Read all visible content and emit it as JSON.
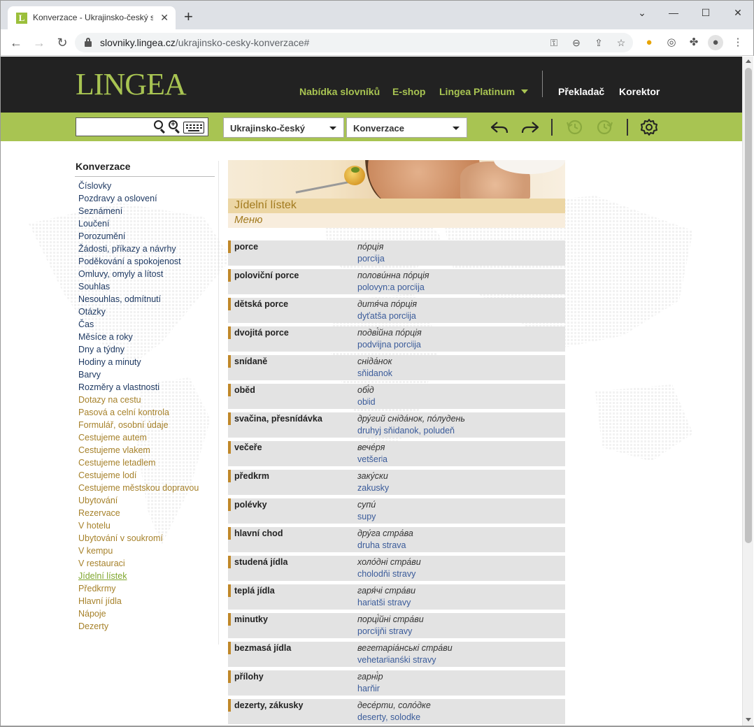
{
  "browser": {
    "tab_title": "Konverzace - Ukrajinsko-český slovník",
    "favicon_letter": "L",
    "url_host": "slovniky.lingea.cz",
    "url_path": "/ukrajinsko-cesky-konverzace#"
  },
  "header": {
    "logo": "LINGEA",
    "nav": {
      "dictionaries": "Nabídka slovníků",
      "eshop": "E-shop",
      "platinum": "Lingea Platinum",
      "translator": "Překladač",
      "corrector": "Korektor"
    }
  },
  "search": {
    "value": "",
    "direction": "Ukrajinsko-český",
    "section": "Konverzace"
  },
  "sidebar": {
    "title": "Konverzace",
    "items": [
      {
        "label": "Číslovky",
        "style": "blue"
      },
      {
        "label": "Pozdravy a oslovení",
        "style": "blue"
      },
      {
        "label": "Seznámení",
        "style": "blue"
      },
      {
        "label": "Loučení",
        "style": "blue"
      },
      {
        "label": "Porozumění",
        "style": "blue"
      },
      {
        "label": "Žádosti, příkazy a návrhy",
        "style": "blue"
      },
      {
        "label": "Poděkování a spokojenost",
        "style": "blue"
      },
      {
        "label": "Omluvy, omyly a lítost",
        "style": "blue"
      },
      {
        "label": "Souhlas",
        "style": "blue"
      },
      {
        "label": "Nesouhlas, odmítnutí",
        "style": "blue"
      },
      {
        "label": "Otázky",
        "style": "blue"
      },
      {
        "label": "Čas",
        "style": "blue"
      },
      {
        "label": "Měsíce a roky",
        "style": "blue"
      },
      {
        "label": "Dny a týdny",
        "style": "blue"
      },
      {
        "label": "Hodiny a minuty",
        "style": "blue"
      },
      {
        "label": "Barvy",
        "style": "blue"
      },
      {
        "label": "Rozměry a vlastnosti",
        "style": "blue"
      },
      {
        "label": "Dotazy na cestu",
        "style": "orange"
      },
      {
        "label": "Pasová a celní kontrola",
        "style": "orange"
      },
      {
        "label": "Formulář, osobní údaje",
        "style": "orange"
      },
      {
        "label": "Cestujeme autem",
        "style": "orange"
      },
      {
        "label": "Cestujeme vlakem",
        "style": "orange"
      },
      {
        "label": "Cestujeme letadlem",
        "style": "orange"
      },
      {
        "label": "Cestujeme lodí",
        "style": "orange"
      },
      {
        "label": "Cestujeme městskou dopravou",
        "style": "orange"
      },
      {
        "label": "Ubytování",
        "style": "orange"
      },
      {
        "label": "Rezervace",
        "style": "orange"
      },
      {
        "label": "V hotelu",
        "style": "orange"
      },
      {
        "label": "Ubytování v soukromí",
        "style": "orange"
      },
      {
        "label": "V kempu",
        "style": "orange"
      },
      {
        "label": "V restauraci",
        "style": "orange"
      },
      {
        "label": "Jídelní lístek",
        "style": "active"
      },
      {
        "label": "Předkrmy",
        "style": "orange"
      },
      {
        "label": "Hlavní jídla",
        "style": "orange"
      },
      {
        "label": "Nápoje",
        "style": "orange"
      },
      {
        "label": "Dezerty",
        "style": "orange"
      }
    ]
  },
  "main": {
    "title": "Jídelní lístek",
    "subtitle": "Меню",
    "entries": [
      {
        "cs": "porce",
        "uk": "по́рція",
        "tr": "porcʲija"
      },
      {
        "cs": "poloviční porce",
        "uk": "полови́нна по́рція",
        "tr": "polovyn:a porcʲija"
      },
      {
        "cs": "dětská porce",
        "uk": "дитя́ча по́рція",
        "tr": "dyťatša porcʲija"
      },
      {
        "cs": "dvojitá porce",
        "uk": "подві́йна по́рція",
        "tr": "podvʲijna porcʲija"
      },
      {
        "cs": "snídaně",
        "uk": "сніда́нок",
        "tr": "sňidanok"
      },
      {
        "cs": "oběd",
        "uk": "обі́д",
        "tr": "obʲid"
      },
      {
        "cs": "svačina, přesnídávka",
        "uk": "дру́гий сніда́нок, по́лудень",
        "tr": "druhyj sňidanok, poludeň"
      },
      {
        "cs": "večeře",
        "uk": "вече́ря",
        "tr": "vetšerʲa"
      },
      {
        "cs": "předkrm",
        "uk": "заку́ски",
        "tr": "zakusky"
      },
      {
        "cs": "polévky",
        "uk": "супи́",
        "tr": "supy"
      },
      {
        "cs": "hlavní chod",
        "uk": "дру́га стра́ва",
        "tr": "druha strava"
      },
      {
        "cs": "studená jídla",
        "uk": "холо́дні стра́ви",
        "tr": "cholodňi stravy"
      },
      {
        "cs": "teplá jídla",
        "uk": "гаря́чі стра́ви",
        "tr": "harʲatši stravy"
      },
      {
        "cs": "minutky",
        "uk": "порці́йні стра́ви",
        "tr": "porcʲijňi stravy"
      },
      {
        "cs": "bezmasá jídla",
        "uk": "вегетаріа́нські стра́ви",
        "tr": "vehetarʲianśki stravy"
      },
      {
        "cs": "přílohy",
        "uk": "гарні́р",
        "tr": "harňir"
      },
      {
        "cs": "dezerty, zákusky",
        "uk": "десе́рти, соло́дке",
        "tr": "deserty, solodke"
      }
    ]
  },
  "colors": {
    "brand_green": "#a8c452",
    "header_dark": "#222222",
    "accent_orange": "#a6812a",
    "link_blue": "#1f3a63",
    "entry_marker": "#c0882a"
  }
}
